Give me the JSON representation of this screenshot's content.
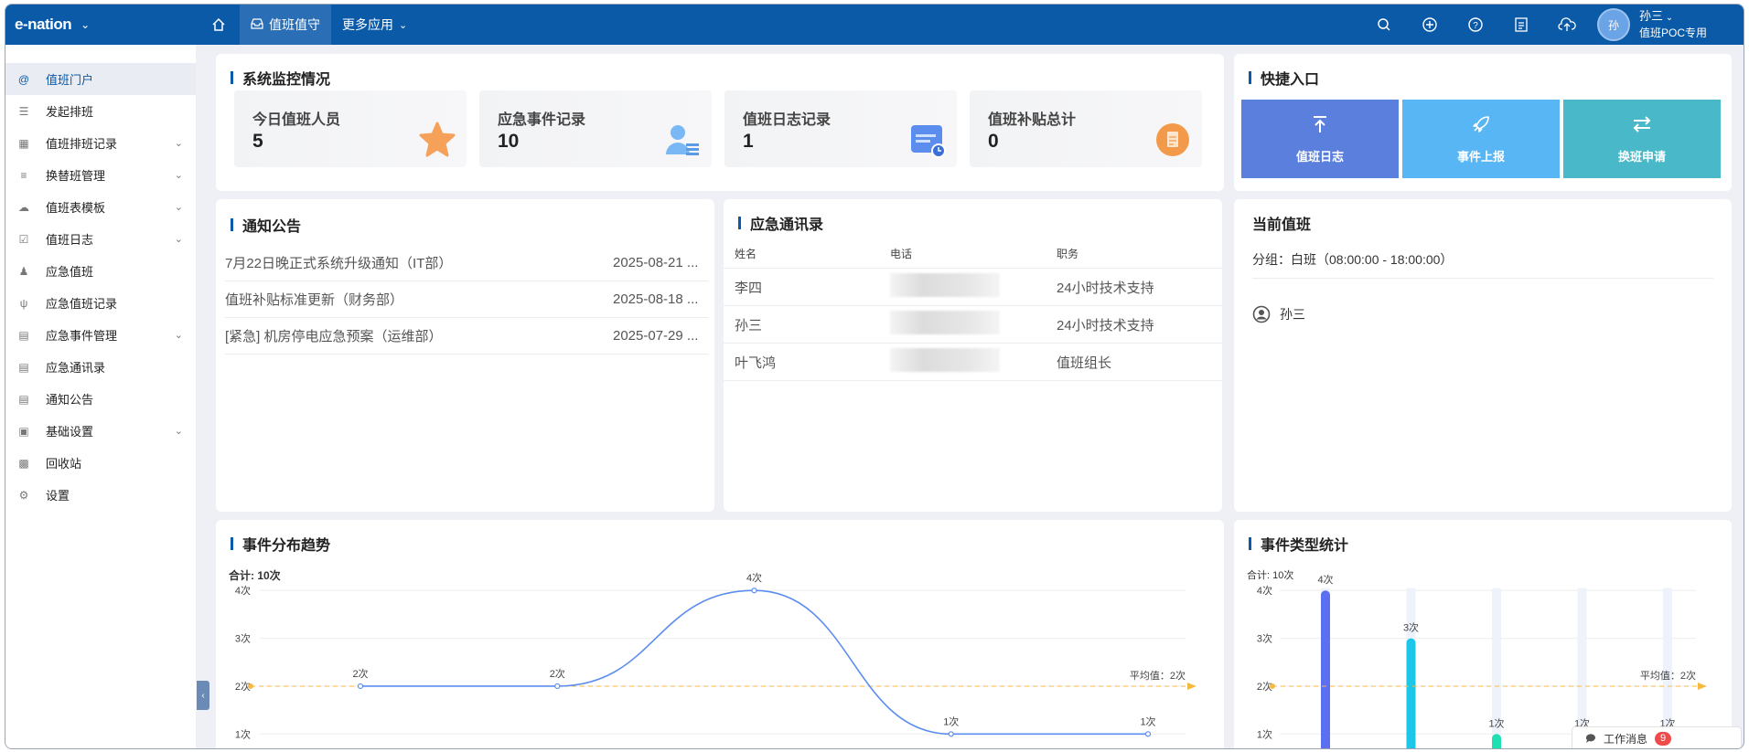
{
  "topbar": {
    "logo": "e-nation",
    "active_tab": "值班值守",
    "more_apps": "更多应用",
    "user_name": "孙三",
    "user_role": "值班POC专用",
    "avatar_text": "孙"
  },
  "sidebar": {
    "items": [
      {
        "label": "值班门户",
        "icon": "at-icon",
        "active": true,
        "expandable": false
      },
      {
        "label": "发起排班",
        "icon": "layers-icon",
        "expandable": false
      },
      {
        "label": "值班排班记录",
        "icon": "table-icon",
        "expandable": true
      },
      {
        "label": "换替班管理",
        "icon": "list-icon",
        "expandable": true
      },
      {
        "label": "值班表模板",
        "icon": "cloud-icon",
        "expandable": true
      },
      {
        "label": "值班日志",
        "icon": "checkbox-icon",
        "expandable": true
      },
      {
        "label": "应急值班",
        "icon": "people-icon",
        "expandable": false
      },
      {
        "label": "应急值班记录",
        "icon": "fork-icon",
        "expandable": false
      },
      {
        "label": "应急事件管理",
        "icon": "monitor-icon",
        "expandable": true
      },
      {
        "label": "应急通讯录",
        "icon": "doc-icon",
        "expandable": false
      },
      {
        "label": "通知公告",
        "icon": "report-icon",
        "expandable": false
      },
      {
        "label": "基础设置",
        "icon": "settings-box-icon",
        "expandable": true
      },
      {
        "label": "回收站",
        "icon": "trash-icon",
        "expandable": false
      },
      {
        "label": "设置",
        "icon": "gear-icon",
        "expandable": false
      }
    ]
  },
  "monitor": {
    "title": "系统监控情况",
    "stats": [
      {
        "label": "今日值班人员",
        "value": "5",
        "icon": "star-icon"
      },
      {
        "label": "应急事件记录",
        "value": "10",
        "icon": "user-list-icon"
      },
      {
        "label": "值班日志记录",
        "value": "1",
        "icon": "calendar-log-icon"
      },
      {
        "label": "值班补贴总计",
        "value": "0",
        "icon": "document-icon"
      }
    ]
  },
  "quick": {
    "title": "快捷入口",
    "buttons": [
      {
        "label": "值班日志",
        "icon": "upload-arrow-icon",
        "color": "#5b7fdc"
      },
      {
        "label": "事件上报",
        "icon": "rocket-icon",
        "color": "#58b6f4"
      },
      {
        "label": "换班申请",
        "icon": "swap-icon",
        "color": "#49b9c9"
      }
    ]
  },
  "notice": {
    "title": "通知公告",
    "rows": [
      {
        "text": "7月22日晚正式系统升级通知（IT部）",
        "date": "2025-08-21 ..."
      },
      {
        "text": "值班补贴标准更新（财务部）",
        "date": "2025-08-18 ..."
      },
      {
        "text": "[紧急] 机房停电应急预案（运维部）",
        "date": "2025-07-29 ..."
      }
    ]
  },
  "contacts": {
    "title": "应急通讯录",
    "headers": [
      "姓名",
      "电话",
      "职务"
    ],
    "rows": [
      {
        "name": "李四",
        "role": "24小时技术支持"
      },
      {
        "name": "孙三",
        "role": "24小时技术支持"
      },
      {
        "name": "叶飞鸿",
        "role": "值班组长"
      }
    ]
  },
  "duty": {
    "title": "当前值班",
    "group": "分组：白班（08:00:00 - 18:00:00）",
    "person": "孙三"
  },
  "trend": {
    "title": "事件分布趋势",
    "total": "合计: 10次",
    "avg_label": "平均值：2次"
  },
  "types": {
    "title": "事件类型统计",
    "total": "合计: 10次",
    "avg_label": "平均值：2次"
  },
  "chart_data": [
    {
      "type": "line",
      "title": "事件分布趋势",
      "total": "合计: 10次",
      "y_ticks": [
        "1次",
        "2次",
        "3次",
        "4次"
      ],
      "ylim": [
        0.7,
        4.1
      ],
      "values": [
        2,
        2,
        4,
        1,
        1
      ],
      "point_labels": [
        "2次",
        "2次",
        "4次",
        "1次",
        "1次"
      ],
      "average": 2,
      "average_label": "平均值：2次",
      "series_color": "#5b8def",
      "average_color": "#f5b942"
    },
    {
      "type": "bar",
      "title": "事件类型统计",
      "total": "合计: 10次",
      "y_ticks": [
        "1次",
        "2次",
        "3次",
        "4次"
      ],
      "ylim": [
        0.7,
        4.1
      ],
      "values": [
        4,
        3,
        1,
        1,
        1
      ],
      "bar_labels": [
        "4次",
        "3次",
        "1次",
        "1次",
        "1次"
      ],
      "bar_colors": [
        "#5b6ff0",
        "#1cc6e8",
        "#1ee0b0",
        "#5b8def",
        "#5b8def"
      ],
      "average": 2,
      "average_label": "平均值：2次",
      "average_color": "#f5b942"
    }
  ],
  "work_message": {
    "label": "工作消息",
    "count": "9"
  }
}
